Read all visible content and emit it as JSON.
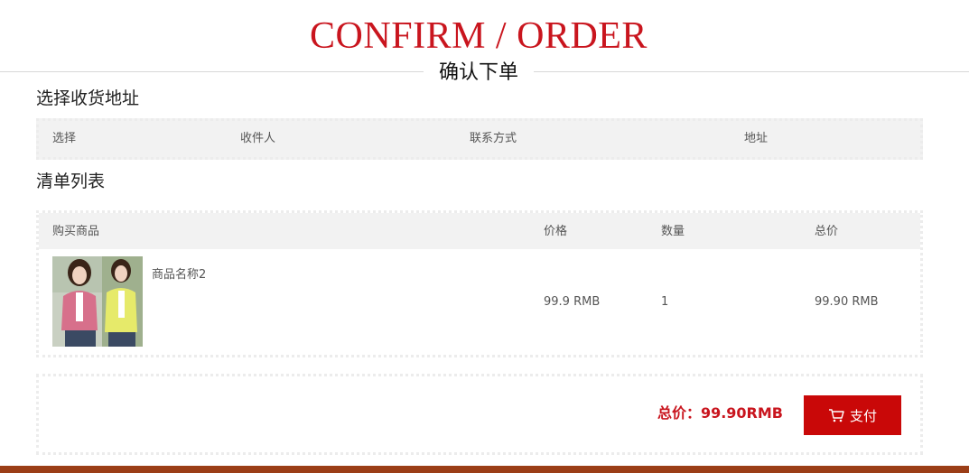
{
  "header": {
    "title_en": "CONFIRM / ORDER",
    "title_cn": "确认下单"
  },
  "address_section": {
    "title": "选择收货地址",
    "columns": [
      "选择",
      "收件人",
      "联系方式",
      "地址"
    ]
  },
  "list_section": {
    "title": "清单列表",
    "columns": [
      "购买商品",
      "价格",
      "数量",
      "总价"
    ],
    "items": [
      {
        "name": "商品名称2",
        "price": "99.9 RMB",
        "quantity": "1",
        "subtotal": "99.90 RMB"
      }
    ]
  },
  "summary": {
    "total_label": "总价：99.90RMB",
    "pay_label": "支付",
    "pay_icon": "cart-icon"
  },
  "colors": {
    "accent": "#c9151e",
    "button": "#c90808",
    "footer": "#9b3e17",
    "header_row": "#f2f2f2"
  }
}
